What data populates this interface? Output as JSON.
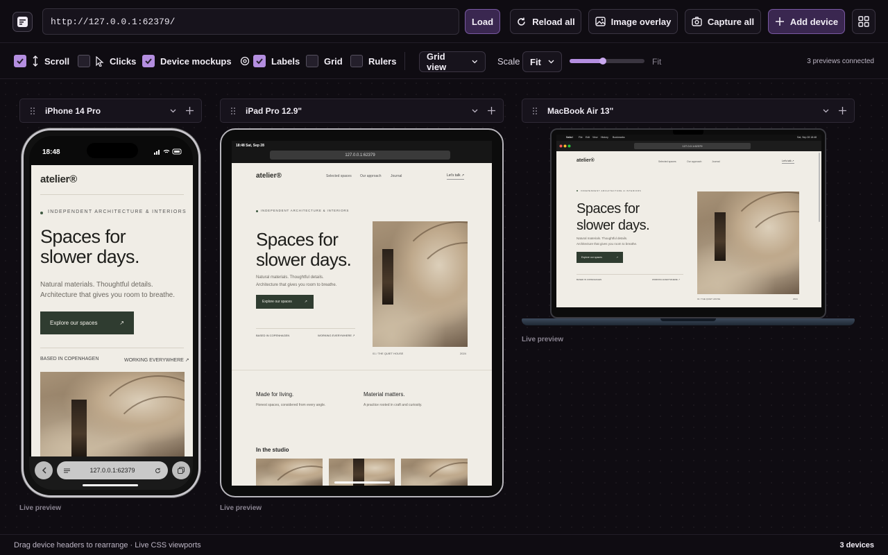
{
  "topbar": {
    "url_value": "http://127.0.0.1:62379/",
    "load_label": "Load",
    "reload_label": "Reload all",
    "overlay_label": "Image overlay",
    "capture_label": "Capture all",
    "add_label": "Add device"
  },
  "toolbar": {
    "scroll_label": "Scroll",
    "clicks_label": "Clicks",
    "mockups_label": "Device mockups",
    "labels_label": "Labels",
    "grid_label": "Grid",
    "rulers_label": "Rulers",
    "view_value": "Grid view",
    "scale_label": "Scale",
    "scale_value": "Fit",
    "fit_label": "Fit",
    "connected_text": "3 previews connected",
    "scroll_on": true,
    "clicks_on": false,
    "mockups_on": true,
    "labels_on": true,
    "grid_on": false,
    "rulers_on": false
  },
  "devices": [
    {
      "name": "iPhone 14 Pro",
      "status": "Live preview"
    },
    {
      "name": "iPad Pro 12.9\"",
      "status": "Live preview"
    },
    {
      "name": "MacBook Air 13\"",
      "status": "Live preview"
    }
  ],
  "site": {
    "brand": "atelier®",
    "nav": [
      "Selected spaces",
      "Our approach",
      "Journal"
    ],
    "nav_cta": "Let's talk ↗",
    "eyebrow": "INDEPENDENT ARCHITECTURE & INTERIORS",
    "headline_1": "Spaces for",
    "headline_2": "slower days.",
    "sub_1": "Natural materials. Thoughtful details.",
    "sub_2": "Architecture that gives you room to breathe.",
    "cta_label": "Explore our spaces",
    "cta_arrow": "↗",
    "based": "BASED IN COPENHAGEN",
    "working": "WORKING EVERYWHERE ↗",
    "caption_left": "01 / THE QUIET HOUSE",
    "caption_right": "2024",
    "feature_1_title": "Made for living.",
    "feature_1_text": "Honest spaces, considered from every angle.",
    "feature_2_title": "Material matters.",
    "feature_2_text": "A practice rooted in craft and curiosity.",
    "studio_title": "In the studio"
  },
  "phone": {
    "time": "18:48",
    "address": "127.0.0.1:62379"
  },
  "tablet": {
    "status_time": "18:48 Sat, Sep 28",
    "address": "127.0.0.1:62379"
  },
  "laptop": {
    "menu": [
      "Safari",
      "File",
      "Edit",
      "View",
      "History",
      "Bookmarks"
    ],
    "clock": "Sat, Sep 28  18:48",
    "address": "127.0.0.1:62379"
  },
  "footer": {
    "hint": "Drag device headers to rearrange · Live CSS viewports",
    "count": "3 devices"
  },
  "colors": {
    "accent": "#b48ee0",
    "primary_button": "#3a2750",
    "site_bg": "#f0ede6",
    "site_cta": "#2f3c30"
  }
}
